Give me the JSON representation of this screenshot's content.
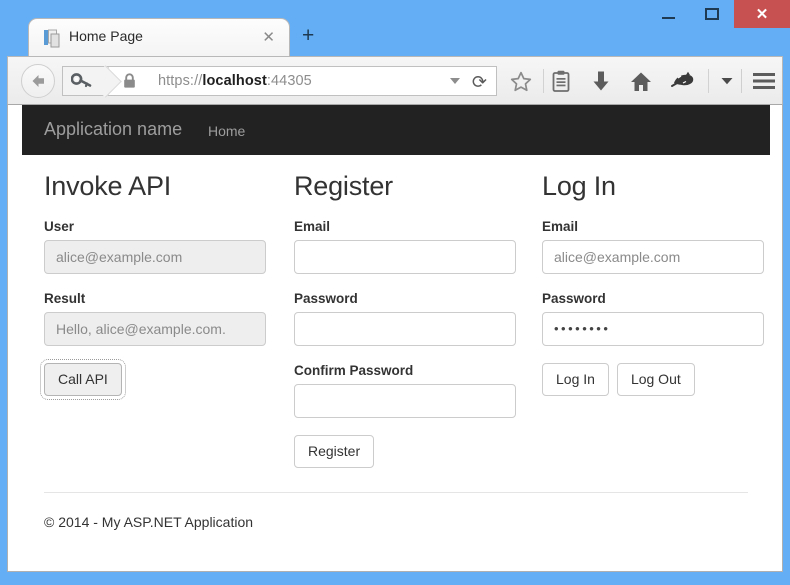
{
  "window": {
    "controls": {
      "minimize": "minimize-button",
      "maximize": "maximize-button",
      "close_glyph": "✕"
    },
    "close_color": "#c75050",
    "frame_color": "#63aef5"
  },
  "browser": {
    "tab": {
      "title": "Home Page",
      "close_glyph": "✕",
      "favicon": "page-document-icon"
    },
    "new_tab_glyph": "+",
    "toolbar": {
      "back_icon": "back-arrow-icon",
      "identity_icon": "key-icon",
      "lock_icon": "padlock-icon",
      "url_scheme": "https://",
      "url_host": "localhost",
      "url_port": ":44305",
      "url_full": "https://localhost:44305",
      "reload_glyph": "⟳",
      "icons": [
        {
          "name": "bookmark-star-icon",
          "label": "Bookmark"
        },
        {
          "name": "reading-list-icon",
          "label": "Reading list"
        },
        {
          "name": "downloads-icon",
          "label": "Downloads"
        },
        {
          "name": "home-icon",
          "label": "Home"
        },
        {
          "name": "feedback-fox-icon",
          "label": "Feedback"
        },
        {
          "name": "overflow-chevron-icon",
          "label": "More"
        },
        {
          "name": "hamburger-menu-icon",
          "label": "Menu"
        }
      ]
    }
  },
  "page": {
    "navbar": {
      "brand": "Application name",
      "links": [
        {
          "label": "Home"
        }
      ],
      "background": "#222222",
      "text_color": "#9d9d9d"
    },
    "columns": {
      "invoke_api": {
        "heading": "Invoke API",
        "user_label": "User",
        "user_value": "alice@example.com",
        "result_label": "Result",
        "result_value": "Hello, alice@example.com.",
        "call_button": "Call API"
      },
      "register": {
        "heading": "Register",
        "email_label": "Email",
        "email_value": "",
        "password_label": "Password",
        "password_value": "",
        "confirm_label": "Confirm Password",
        "confirm_value": "",
        "register_button": "Register"
      },
      "login": {
        "heading": "Log In",
        "email_label": "Email",
        "email_value": "alice@example.com",
        "password_label": "Password",
        "password_value": "••••••••",
        "login_button": "Log In",
        "logout_button": "Log Out"
      }
    },
    "footer": {
      "copyright": "© 2014 - My ASP.NET Application"
    }
  }
}
